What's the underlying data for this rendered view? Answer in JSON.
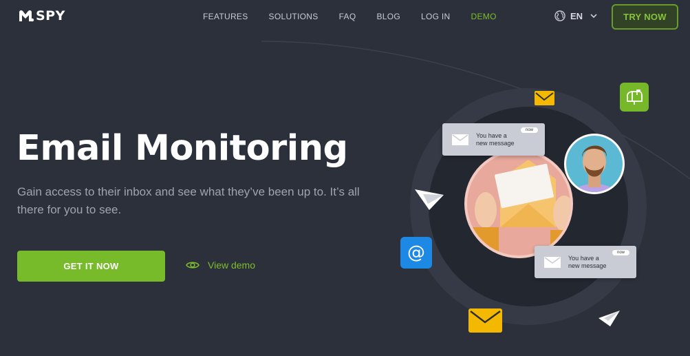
{
  "header": {
    "logo_text": "SPY",
    "nav": [
      {
        "label": "FEATURES",
        "active": false
      },
      {
        "label": "SOLUTIONS",
        "active": false
      },
      {
        "label": "FAQ",
        "active": false
      },
      {
        "label": "BLOG",
        "active": false
      },
      {
        "label": "LOG IN",
        "active": false
      },
      {
        "label": "DEMO",
        "active": true
      }
    ],
    "language": "EN",
    "language_icon": "globe-icon",
    "try_label": "TRY NOW"
  },
  "hero": {
    "title": "Email Monitoring",
    "subtitle": "Gain access to their inbox and see what they’ve been up to. It’s all there for you to see.",
    "cta_label": "GET IT NOW",
    "demo_label": "View demo",
    "demo_icon": "eye-icon"
  },
  "illustration": {
    "card_top": {
      "text_line1": "You have a",
      "text_line2": "new message",
      "badge": "now"
    },
    "card_bottom": {
      "text_line1": "You have a",
      "text_line2": "new message",
      "badge": "now"
    },
    "icons": [
      "envelope-icon",
      "mailbox-icon",
      "at-sign-icon",
      "paper-plane-icon",
      "avatar"
    ]
  },
  "colors": {
    "background": "#2c303b",
    "accent": "#77ba2a",
    "accent_text": "#7dbd2c",
    "envelope": "#f5b800",
    "at_badge": "#1e88e5",
    "mailbox_badge": "#76b82a",
    "photo_bg": "#e8a89c"
  }
}
